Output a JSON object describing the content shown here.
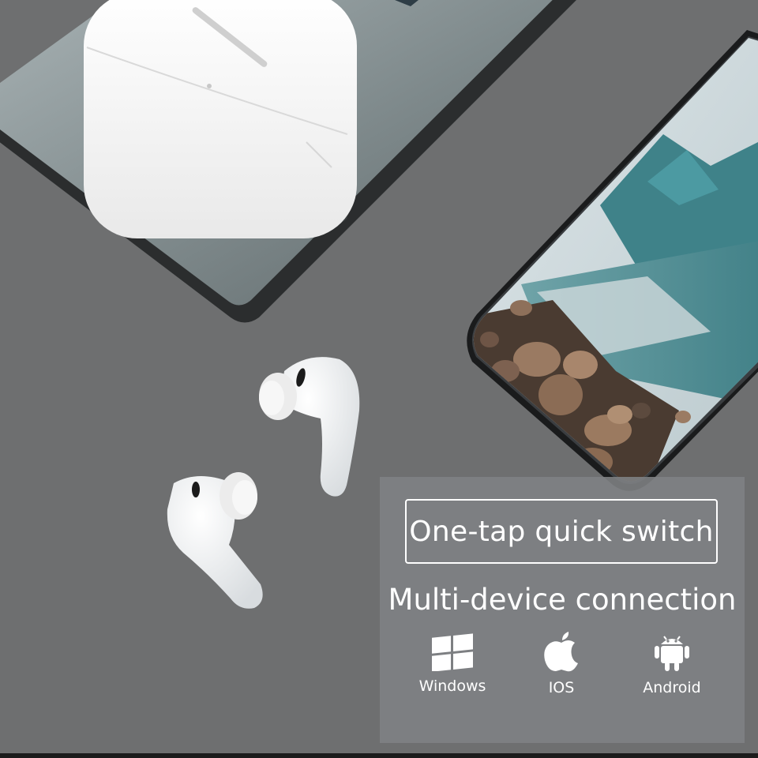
{
  "product": {
    "headline": "One-tap quick switch",
    "subheadline": "Multi-device connection",
    "platforms": [
      {
        "label": "Windows",
        "icon": "windows-logo-icon"
      },
      {
        "label": "IOS",
        "icon": "apple-logo-icon"
      },
      {
        "label": "Android",
        "icon": "android-robot-icon"
      }
    ]
  },
  "colors": {
    "background": "#6e6f70",
    "panel_overlay": "#808284",
    "text": "#ffffff"
  }
}
